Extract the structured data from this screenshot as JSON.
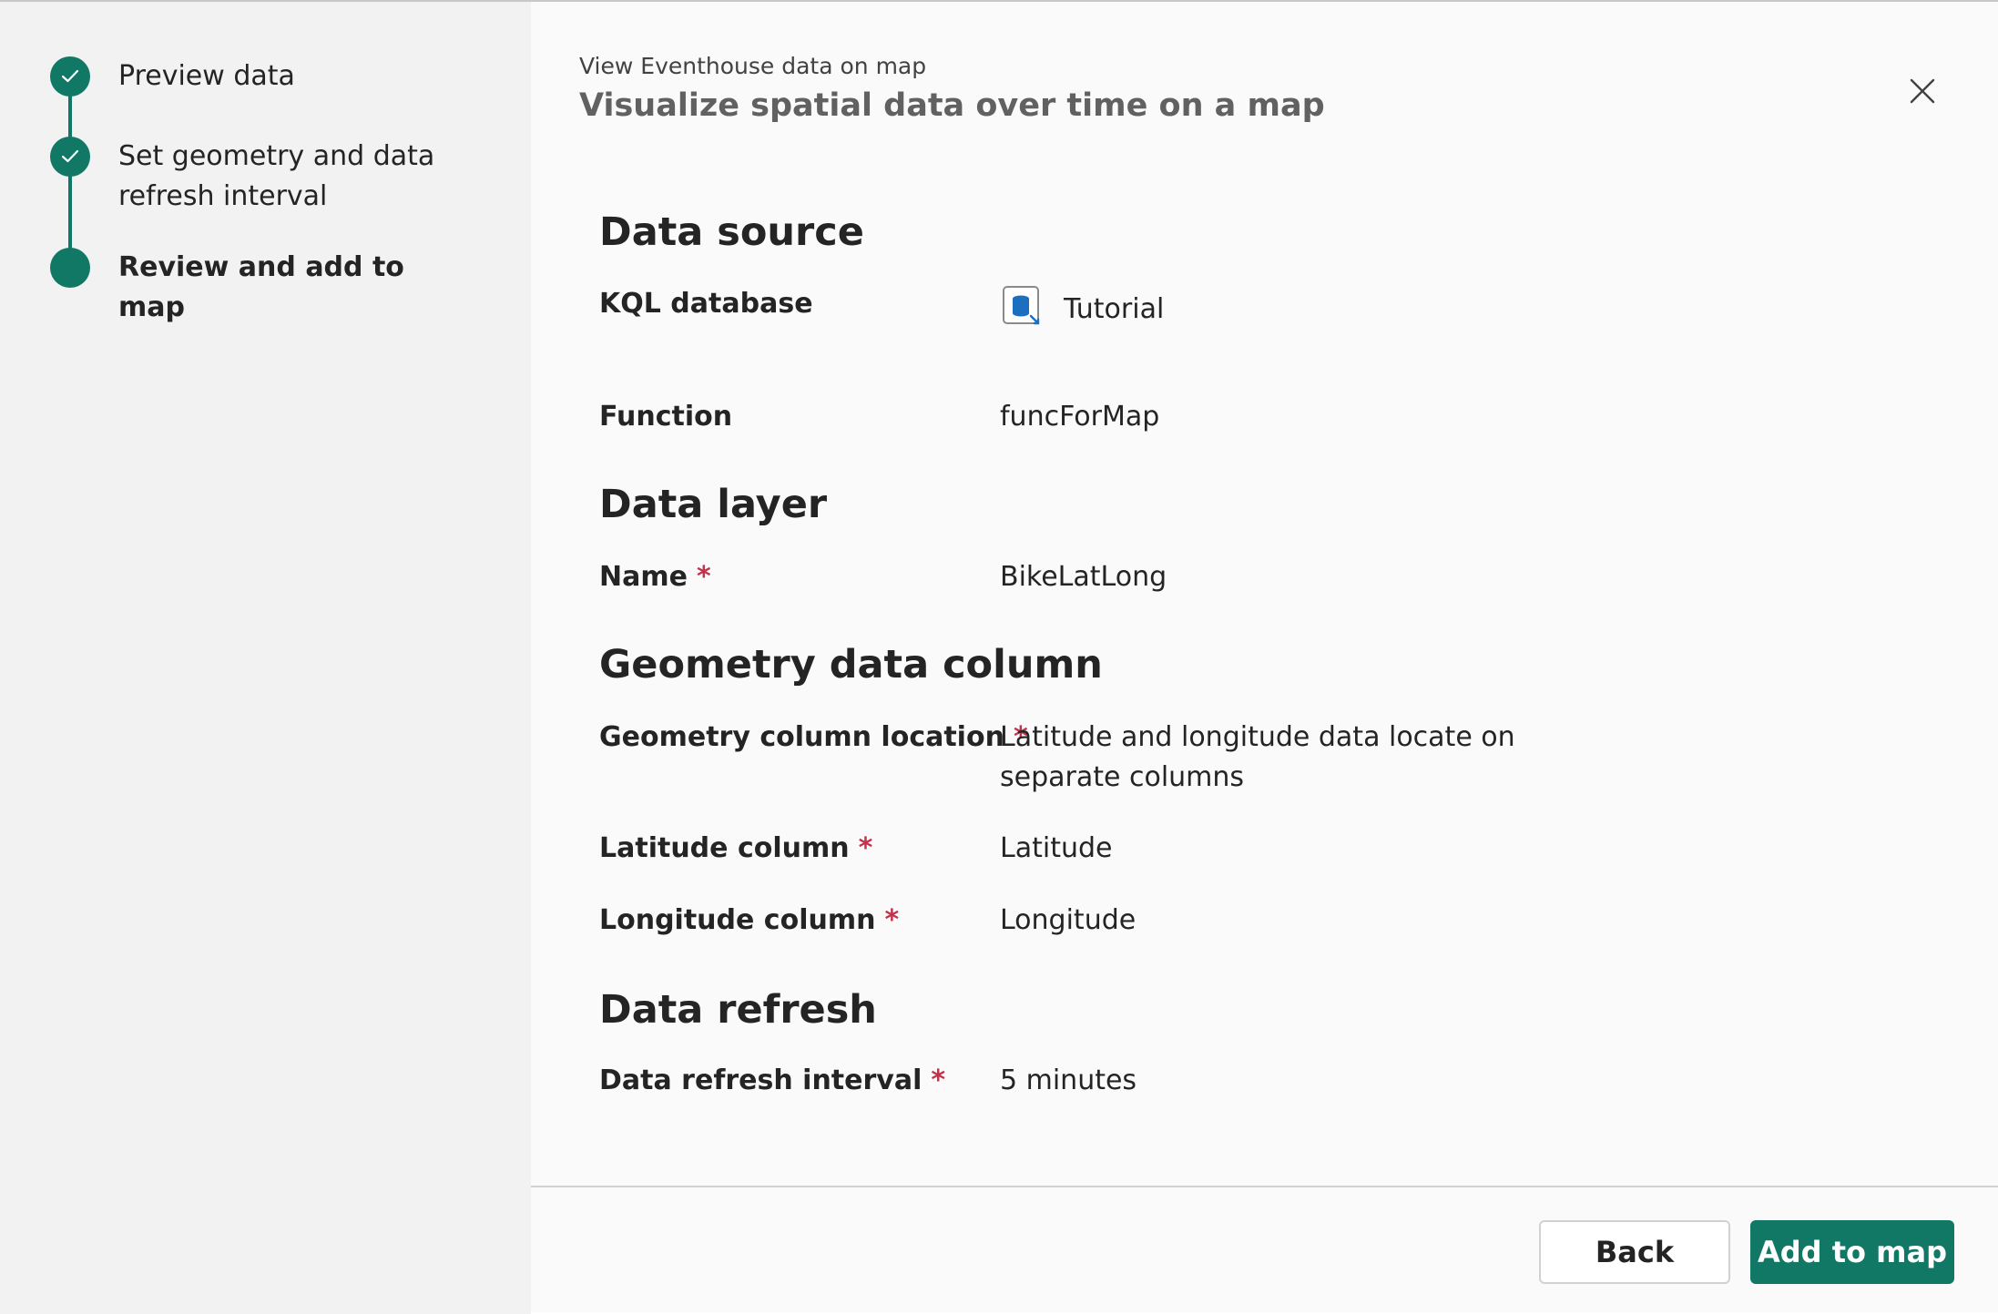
{
  "stepper": {
    "steps": [
      {
        "label": "Preview data",
        "status": "completed"
      },
      {
        "label": "Set geometry and data refresh interval",
        "status": "completed"
      },
      {
        "label": "Review and add to map",
        "status": "current"
      }
    ]
  },
  "header": {
    "eyebrow": "View Eventhouse data on map",
    "title": "Visualize spatial data over time on a map",
    "close_icon": "close-icon"
  },
  "sections": {
    "data_source": {
      "title": "Data source",
      "kql_database_label": "KQL database",
      "kql_database_value": "Tutorial",
      "kql_database_icon": "kql-database-icon",
      "function_label": "Function",
      "function_value": "funcForMap"
    },
    "data_layer": {
      "title": "Data layer",
      "name_label": "Name",
      "name_value": "BikeLatLong"
    },
    "geometry": {
      "title": "Geometry data column",
      "location_label": "Geometry column location",
      "location_value": "Latitude and longitude data locate on separate columns",
      "latitude_label": "Latitude column",
      "latitude_value": "Latitude",
      "longitude_label": "Longitude column",
      "longitude_value": "Longitude"
    },
    "data_refresh": {
      "title": "Data refresh",
      "interval_label": "Data refresh interval",
      "interval_value": "5 minutes"
    }
  },
  "required_marker": "*",
  "footer": {
    "back_label": "Back",
    "add_label": "Add to map"
  },
  "colors": {
    "accent": "#117865",
    "required": "#c4314b"
  }
}
